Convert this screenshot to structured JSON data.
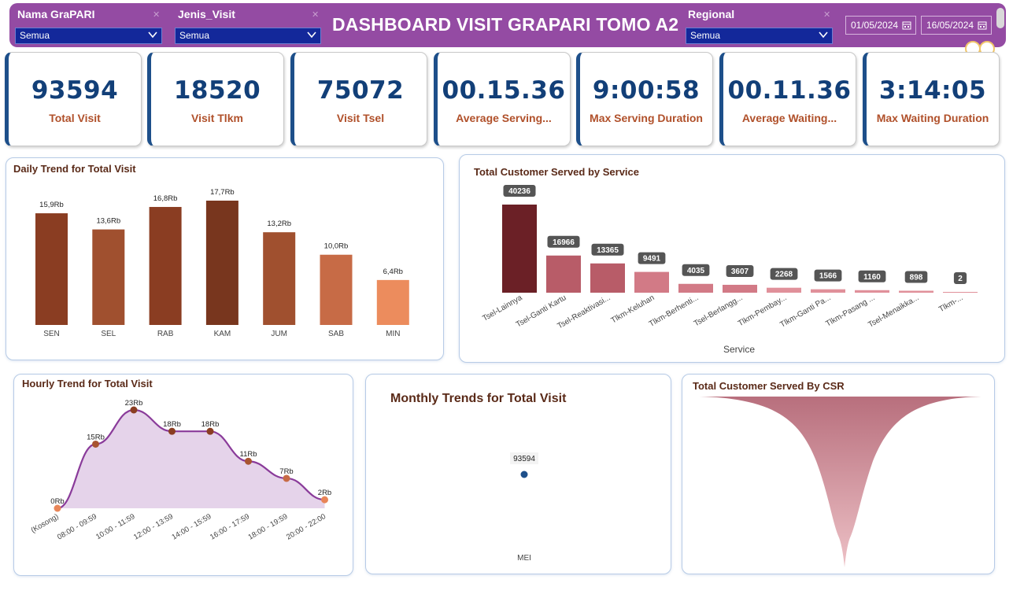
{
  "header": {
    "title": "DASHBOARD VISIT GRAPARI TOMO A2",
    "filters": [
      {
        "label": "Nama GraPARI",
        "value": "Semua"
      },
      {
        "label": "Jenis_Visit",
        "value": "Semua"
      },
      {
        "label": "Regional",
        "value": "Semua"
      }
    ],
    "date_start": "01/05/2024",
    "date_end": "16/05/2024"
  },
  "kpis": [
    {
      "value": "93594",
      "label": "Total Visit"
    },
    {
      "value": "18520",
      "label": "Visit Tlkm"
    },
    {
      "value": "75072",
      "label": "Visit Tsel"
    },
    {
      "value": "00.15.36",
      "label": "Average Serving..."
    },
    {
      "value": "9:00:58",
      "label": "Max Serving Duration"
    },
    {
      "value": "00.11.36",
      "label": "Average Waiting..."
    },
    {
      "value": "3:14:05",
      "label": "Max Waiting Duration"
    }
  ],
  "colors": {
    "header_bg": "#944ba3",
    "dropdown_bg": "#13289a",
    "kpi_value": "#123f78",
    "kpi_label": "#b0502a",
    "daily_bar": [
      "#8a3d22",
      "#a0502f",
      "#8a3d22",
      "#78361e",
      "#a0502f",
      "#c76b46",
      "#ec8c5d"
    ],
    "service_bar_first": "#6b2026",
    "service_bar": "#c86b77",
    "hourly_line": "#8a3b9a",
    "hourly_fill": "#e5d3ea",
    "monthly_point": "#1d4f8a"
  },
  "chart_data": [
    {
      "id": "daily",
      "type": "bar",
      "title": "Daily Trend for Total Visit",
      "categories": [
        "SEN",
        "SEL",
        "RAB",
        "KAM",
        "JUM",
        "SAB",
        "MIN"
      ],
      "values": [
        15900,
        13600,
        16800,
        17700,
        13200,
        10000,
        6400
      ],
      "data_labels": [
        "15,9Rb",
        "13,6Rb",
        "16,8Rb",
        "17,7Rb",
        "13,2Rb",
        "10,0Rb",
        "6,4Rb"
      ],
      "ylim": [
        0,
        17700
      ]
    },
    {
      "id": "service",
      "type": "bar",
      "title": "Total Customer Served by Service",
      "xlabel": "Service",
      "categories": [
        "Tsel-Lainnya",
        "Tsel-Ganti Kartu",
        "Tsel-Reaktivasi...",
        "Tlkm-Keluhan",
        "Tlkm-Berhenti...",
        "Tsel-Berlangg...",
        "Tlkm-Pembay...",
        "Tlkm-Ganti Pa...",
        "Tlkm-Pasang ...",
        "Tsel-Menaikka...",
        "Tlkm-..."
      ],
      "values": [
        40236,
        16966,
        13365,
        9491,
        4035,
        3607,
        2268,
        1566,
        1160,
        898,
        2
      ],
      "ylim": [
        0,
        40236
      ]
    },
    {
      "id": "hourly",
      "type": "area",
      "title": "Hourly Trend for Total Visit",
      "x": [
        "(Kosong)",
        "08:00 - 09:59",
        "10:00 - 11:59",
        "12:00 - 13:59",
        "14:00 - 15:59",
        "16:00 - 17:59",
        "18:00 - 19:59",
        "20:00 - 22:00"
      ],
      "values": [
        0,
        15000,
        23000,
        18000,
        18000,
        11000,
        7000,
        2000
      ],
      "data_labels": [
        "0Rb",
        "15Rb",
        "23Rb",
        "18Rb",
        "18Rb",
        "11Rb",
        "7Rb",
        "2Rb"
      ],
      "ylim": [
        0,
        23000
      ]
    },
    {
      "id": "monthly",
      "type": "scatter",
      "title": "Monthly Trends for Total Visit",
      "x": [
        "MEI"
      ],
      "values": [
        93594
      ],
      "data_labels": [
        "93594"
      ]
    },
    {
      "id": "csr",
      "type": "area",
      "title": "Total Customer Served By CSR"
    }
  ]
}
